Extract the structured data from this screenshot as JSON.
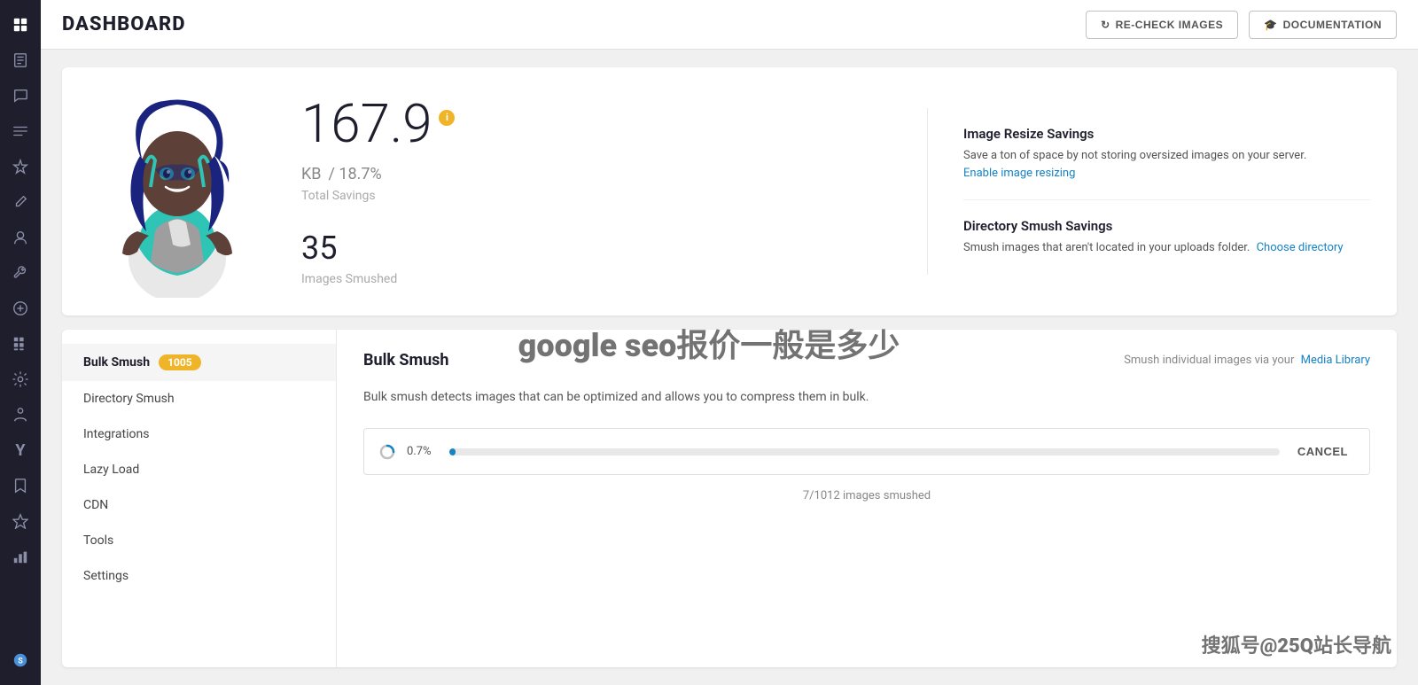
{
  "page": {
    "title": "DASHBOARD"
  },
  "header": {
    "recheck_label": "RE-CHECK IMAGES",
    "documentation_label": "DOCUMENTATION"
  },
  "stats": {
    "savings_number": "167.9",
    "savings_unit": "KB",
    "savings_percent": "/ 18.7%",
    "savings_label": "Total Savings",
    "images_smushed_count": "35",
    "images_smushed_label": "Images Smushed"
  },
  "right_panel": {
    "resize_title": "Image Resize Savings",
    "resize_desc": "Save a ton of space by not storing oversized images on your server.",
    "resize_link": "Enable image resizing",
    "directory_title": "Directory Smush Savings",
    "directory_desc": "Smush images that aren't located in your uploads folder.",
    "directory_link": "Choose directory"
  },
  "nav": {
    "items": [
      {
        "label": "Bulk Smush",
        "badge": "1005",
        "active": true
      },
      {
        "label": "Directory Smush",
        "badge": null,
        "active": false
      },
      {
        "label": "Integrations",
        "badge": null,
        "active": false
      },
      {
        "label": "Lazy Load",
        "badge": null,
        "active": false
      },
      {
        "label": "CDN",
        "badge": null,
        "active": false
      },
      {
        "label": "Tools",
        "badge": null,
        "active": false
      },
      {
        "label": "Settings",
        "badge": null,
        "active": false
      }
    ]
  },
  "bulk_smush": {
    "title": "Bulk Smush",
    "subtitle_prefix": "Smush individual images via your",
    "subtitle_link": "Media Library",
    "description": "Bulk smush detects images that can be optimized and allows you to compress them in bulk.",
    "progress_percent": "0.7%",
    "cancel_label": "CANCEL",
    "status": "7/1012 images smushed"
  },
  "watermark": "google seo报价一般是多少",
  "watermark2": "搜狐号@25Q站长导航"
}
